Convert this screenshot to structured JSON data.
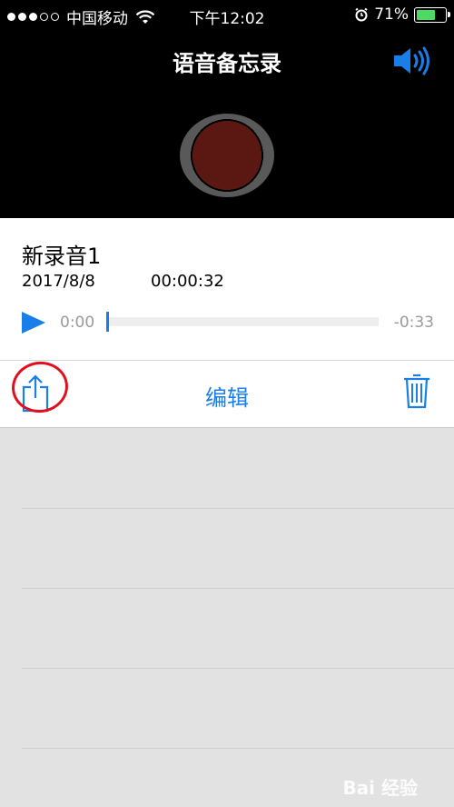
{
  "status_bar": {
    "carrier": "中国移动",
    "time": "下午12:02",
    "battery": "71%",
    "battery_level": 0.71
  },
  "header": {
    "title": "语音备忘录"
  },
  "recording": {
    "name": "新录音1",
    "date": "2017/8/8",
    "duration": "00:00:32",
    "elapsed": "0:00",
    "remaining": "-0:33"
  },
  "actions": {
    "edit_label": "编辑"
  },
  "watermark": "Bai 经验",
  "colors": {
    "accent": "#1a7ee8",
    "record": "#5c1712",
    "annotation": "#e0101d",
    "battery": "#4cd964"
  }
}
